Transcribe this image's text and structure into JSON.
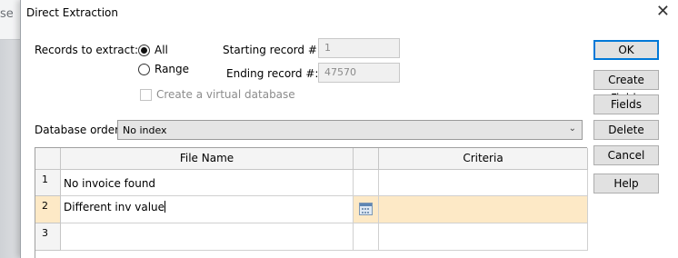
{
  "background_window": {
    "partial_text": "se"
  },
  "dialog": {
    "title": "Direct Extraction",
    "close_glyph": "✕",
    "records_to_extract_label": "Records to extract:",
    "radio_all_label": "All",
    "radio_all_checked": true,
    "radio_range_label": "Range",
    "radio_range_checked": false,
    "virtual_db_label": "Create a virtual database",
    "virtual_db_checked": false,
    "starting_record_label": "Starting record #:",
    "starting_record_value": "1",
    "ending_record_label": "Ending record #:",
    "ending_record_value": "47570",
    "database_order_label": "Database order:",
    "database_order_value": "No index",
    "buttons": {
      "ok": "OK",
      "create_fields": "Create Fields",
      "fields": "Fields",
      "delete": "Delete",
      "cancel": "Cancel",
      "help": "Help"
    },
    "grid": {
      "columns": [
        "File Name",
        "",
        "Criteria"
      ],
      "rows": [
        {
          "num": "1",
          "file_name": "No invoice found",
          "criteria": ""
        },
        {
          "num": "2",
          "file_name": "Different inv value",
          "criteria": ""
        },
        {
          "num": "3",
          "file_name": "",
          "criteria": ""
        }
      ],
      "selected_row": 2,
      "picker_icon": "calendar-grid-icon"
    },
    "colors": {
      "selection": "#fde9c6",
      "default_button_border": "#0078d7"
    }
  }
}
